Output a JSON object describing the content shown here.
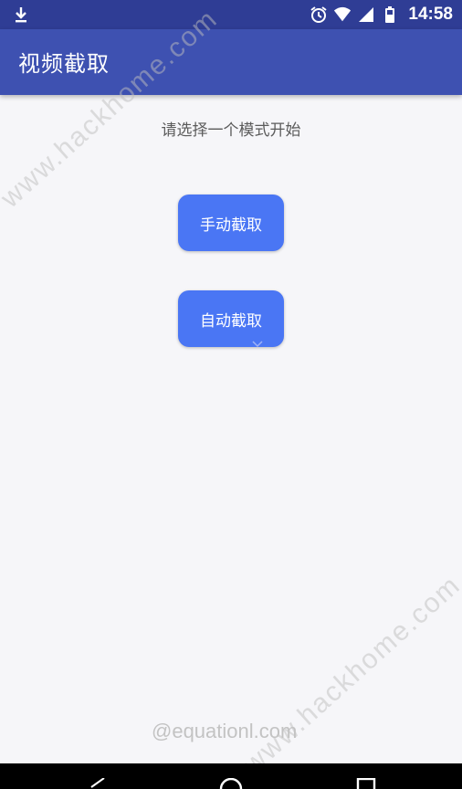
{
  "status_bar": {
    "time": "14:58",
    "icons": [
      "download-icon",
      "alarm-icon",
      "wifi-icon",
      "signal-icon",
      "battery-icon"
    ]
  },
  "app_bar": {
    "title": "视频截取",
    "color": "#3e51b1"
  },
  "main": {
    "prompt": "请选择一个模式开始",
    "buttons": [
      {
        "label": "手动截取"
      },
      {
        "label": "自动截取"
      }
    ],
    "button_color": "#4a76f4"
  },
  "watermarks": {
    "footer": "@equationl.com",
    "diagonal_top": "www.hackhome.com",
    "diagonal_bottom": "www.hackhome.com"
  },
  "nav_bar": {
    "icons": [
      "back-icon",
      "home-icon",
      "recents-icon"
    ]
  }
}
